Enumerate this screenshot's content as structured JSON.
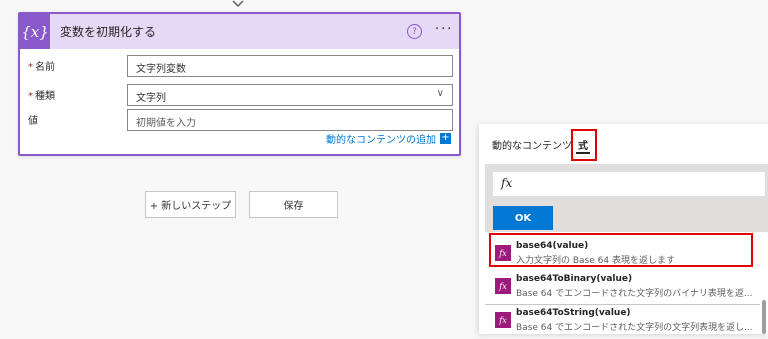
{
  "card": {
    "title": "変数を初期化する",
    "icon_text": "{x}",
    "help_icon": "?",
    "more_icon": "···",
    "fields": [
      {
        "label": "名前",
        "required": true,
        "value": "文字列変数"
      },
      {
        "label": "種類",
        "required": true,
        "value": "文字列"
      },
      {
        "label": "値",
        "required": false,
        "placeholder": "初期値を入力"
      }
    ],
    "dynamic_link": "動的なコンテンツの追加",
    "plus": "+"
  },
  "actions": {
    "new_step": "+ 新しいステップ",
    "save": "保存"
  },
  "panel": {
    "tabs": [
      "動的なコンテンツ",
      "式"
    ],
    "fx_placeholder": "fx",
    "ok_label": "OK",
    "functions": [
      {
        "name": "base64(value)",
        "desc": "入力文字列の Base 64 表現を返します"
      },
      {
        "name": "base64ToBinary(value)",
        "desc": "Base 64 でエンコードされた文字列のバイナリ表現を返..."
      },
      {
        "name": "base64ToString(value)",
        "desc": "Base 64 でエンコードされた文字列の文字列表現を返し..."
      }
    ]
  },
  "colors": {
    "accent_purple": "#8a59cb",
    "header_bg": "#e6d9f6",
    "link_blue": "#0078d4",
    "fx_icon": "#9e1b7e",
    "highlight_red": "#e00000"
  }
}
